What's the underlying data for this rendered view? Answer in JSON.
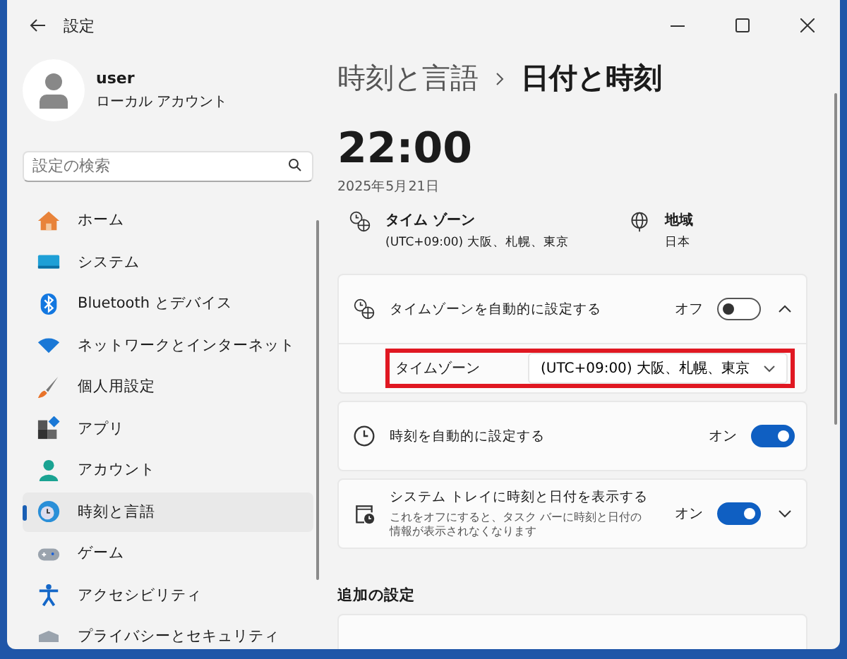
{
  "window": {
    "title": "設定"
  },
  "account": {
    "name": "user",
    "type": "ローカル アカウント"
  },
  "search": {
    "placeholder": "設定の検索"
  },
  "nav": [
    {
      "kind": "home",
      "label": "ホーム",
      "selected": false
    },
    {
      "kind": "system",
      "label": "システム",
      "selected": false
    },
    {
      "kind": "bluetooth",
      "label": "Bluetooth とデバイス",
      "selected": false
    },
    {
      "kind": "network",
      "label": "ネットワークとインターネット",
      "selected": false
    },
    {
      "kind": "brush",
      "label": "個人用設定",
      "selected": false
    },
    {
      "kind": "apps",
      "label": "アプリ",
      "selected": false
    },
    {
      "kind": "account",
      "label": "アカウント",
      "selected": false
    },
    {
      "kind": "time",
      "label": "時刻と言語",
      "selected": true
    },
    {
      "kind": "game",
      "label": "ゲーム",
      "selected": false
    },
    {
      "kind": "access",
      "label": "アクセシビリティ",
      "selected": false
    },
    {
      "kind": "privacy",
      "label": "プライバシーとセキュリティ",
      "selected": false
    }
  ],
  "breadcrumb": {
    "parent": "時刻と言語",
    "current": "日付と時刻"
  },
  "clock": {
    "time": "22:00",
    "date": "2025年5月21日"
  },
  "info": [
    {
      "kind": "timezone",
      "label": "タイム ゾーン",
      "value": "(UTC+09:00) 大阪、札幌、東京"
    },
    {
      "kind": "region",
      "label": "地域",
      "value": "日本"
    }
  ],
  "cards": [
    {
      "kind": "timezone",
      "title": "タイムゾーンを自動的に設定する",
      "state_label": "オフ",
      "on": false,
      "expanded": true,
      "detail": {
        "label": "タイムゾーン",
        "value": "(UTC+09:00) 大阪、札幌、東京",
        "highlighted": true
      }
    },
    {
      "kind": "clock",
      "title": "時刻を自動的に設定する",
      "state_label": "オン",
      "on": true
    },
    {
      "kind": "tray",
      "title": "システム トレイに時刻と日付を表示する",
      "description": "これをオフにすると、タスク バーに時刻と日付の情報が表示されなくなります",
      "state_label": "オン",
      "on": true,
      "expanded": false
    }
  ],
  "additional": {
    "heading": "追加の設定"
  }
}
